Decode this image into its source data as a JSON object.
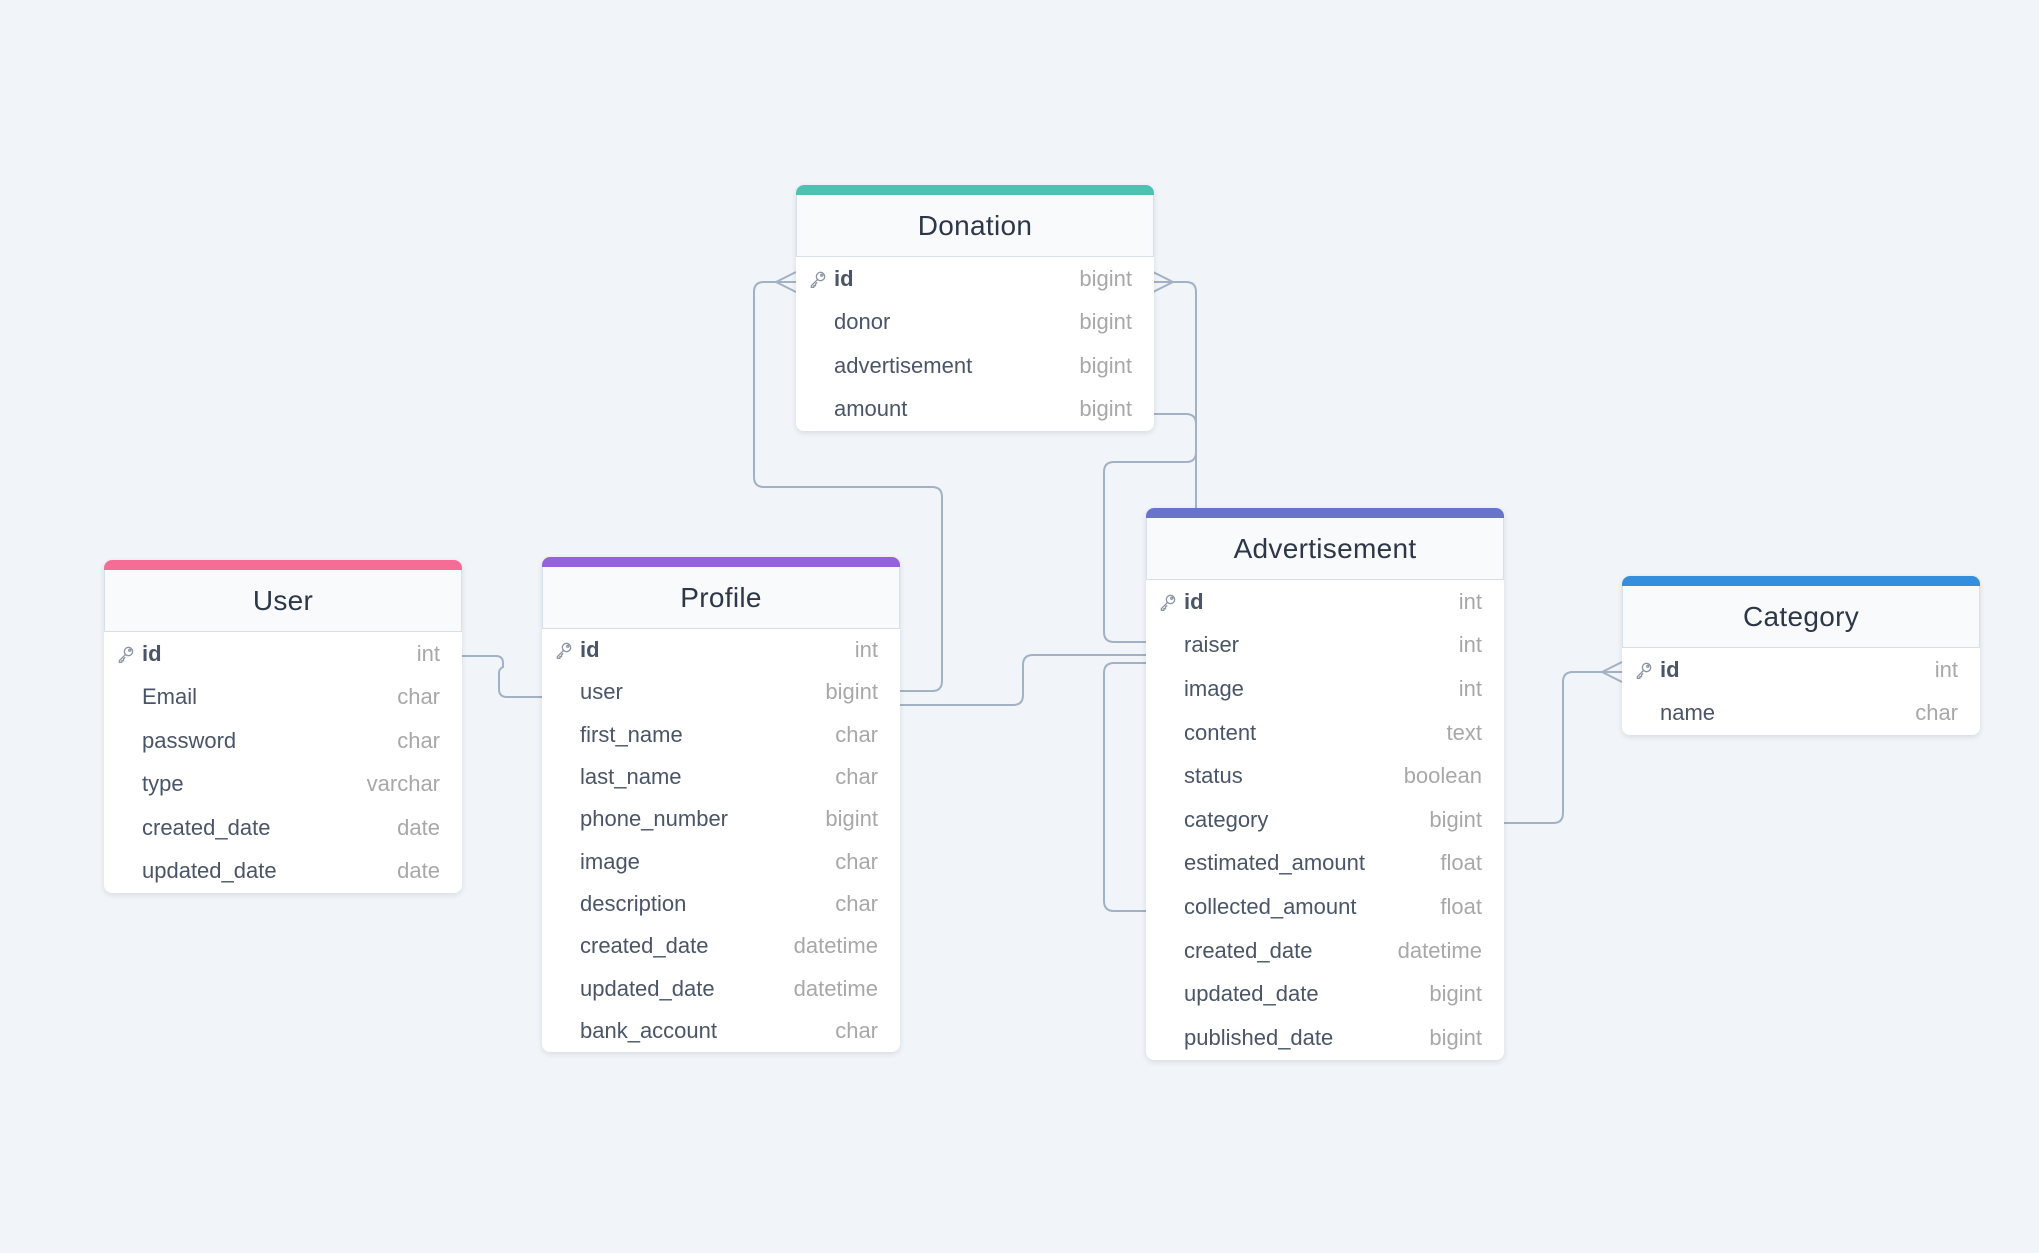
{
  "diagram": {
    "background_color": "#f1f5f9",
    "tables": [
      {
        "id": "user",
        "name": "User",
        "color": "#f56d97",
        "fields": [
          {
            "name": "id",
            "type": "int",
            "pk": true
          },
          {
            "name": "Email",
            "type": "char"
          },
          {
            "name": "password",
            "type": "char"
          },
          {
            "name": "type",
            "type": "varchar"
          },
          {
            "name": "created_date",
            "type": "date"
          },
          {
            "name": "updated_date",
            "type": "date"
          }
        ]
      },
      {
        "id": "profile",
        "name": "Profile",
        "color": "#9461e0",
        "fields": [
          {
            "name": "id",
            "type": "int",
            "pk": true
          },
          {
            "name": "user",
            "type": "bigint"
          },
          {
            "name": "first_name",
            "type": "char"
          },
          {
            "name": "last_name",
            "type": "char"
          },
          {
            "name": "phone_number",
            "type": "bigint"
          },
          {
            "name": "image",
            "type": "char"
          },
          {
            "name": "description",
            "type": "char"
          },
          {
            "name": "created_date",
            "type": "datetime"
          },
          {
            "name": "updated_date",
            "type": "datetime"
          },
          {
            "name": "bank_account",
            "type": "char"
          }
        ]
      },
      {
        "id": "donation",
        "name": "Donation",
        "color": "#4fc1b3",
        "fields": [
          {
            "name": "id",
            "type": "bigint",
            "pk": true
          },
          {
            "name": "donor",
            "type": "bigint"
          },
          {
            "name": "advertisement",
            "type": "bigint"
          },
          {
            "name": "amount",
            "type": "bigint"
          }
        ]
      },
      {
        "id": "advertisement",
        "name": "Advertisement",
        "color": "#6874cc",
        "fields": [
          {
            "name": "id",
            "type": "int",
            "pk": true
          },
          {
            "name": "raiser",
            "type": "int"
          },
          {
            "name": "image",
            "type": "int"
          },
          {
            "name": "content",
            "type": "text"
          },
          {
            "name": "status",
            "type": "boolean"
          },
          {
            "name": "category",
            "type": "bigint"
          },
          {
            "name": "estimated_amount",
            "type": "float"
          },
          {
            "name": "collected_amount",
            "type": "float"
          },
          {
            "name": "created_date",
            "type": "datetime"
          },
          {
            "name": "updated_date",
            "type": "bigint"
          },
          {
            "name": "published_date",
            "type": "bigint"
          }
        ]
      },
      {
        "id": "category",
        "name": "Category",
        "color": "#358fdc",
        "fields": [
          {
            "name": "id",
            "type": "int",
            "pk": true
          },
          {
            "name": "name",
            "type": "char"
          }
        ]
      }
    ],
    "relationships": [
      {
        "from": "user.id",
        "to": "profile.user",
        "kind": "one-to-one"
      },
      {
        "from": "profile.user",
        "to": "donation.id",
        "kind": "one-to-many"
      },
      {
        "from": "profile.user",
        "to": "advertisement.id",
        "kind": "one-to-one"
      },
      {
        "from": "advertisement.id",
        "to": "donation.id",
        "kind": "one-to-many"
      },
      {
        "from": "donation.amount",
        "to": "advertisement.id",
        "kind": "one-to-one"
      },
      {
        "from": "advertisement.raiser",
        "to": "advertisement.collected_amount",
        "kind": "one-to-one"
      },
      {
        "from": "advertisement.category",
        "to": "category.id",
        "kind": "many-to-one"
      }
    ],
    "icons": {
      "primary_key": "key-icon"
    }
  }
}
